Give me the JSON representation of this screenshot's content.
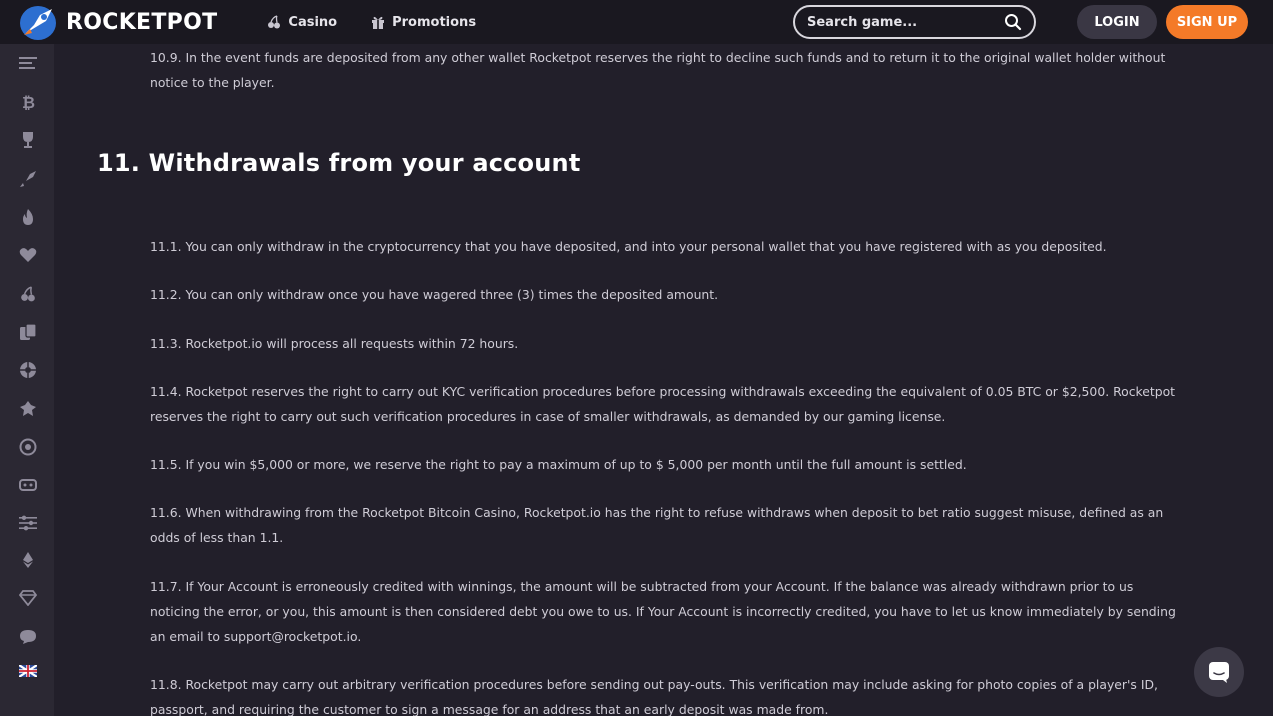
{
  "header": {
    "brand": "ROCKETPOT",
    "nav": [
      {
        "label": "Casino",
        "icon": "cherries-icon"
      },
      {
        "label": "Promotions",
        "icon": "gift-icon"
      }
    ],
    "search_placeholder": "Search game...",
    "login_label": "LOGIN",
    "signup_label": "SIGN UP"
  },
  "sidebar": {
    "items": [
      "menu-icon",
      "bitcoin-icon",
      "trophy-icon",
      "rocket-icon",
      "fire-icon",
      "heart-icon",
      "cherries-icon",
      "cards-icon",
      "roulette-icon",
      "poker-chip-icon",
      "coin-icon",
      "ticket-icon",
      "sliders-icon",
      "ethereum-icon",
      "diamond-icon",
      "chat-icon",
      "uk-flag-icon"
    ]
  },
  "content": {
    "p_10_9": "10.9. In the event funds are deposited from any other wallet Rocketpot reserves the right to decline such funds and to return it to the original wallet holder without notice to the player.",
    "heading": "11. Withdrawals from your account",
    "p_11_1": "11.1. You can only withdraw in the cryptocurrency that you have deposited, and into your personal wallet that you have registered with as you deposited.",
    "p_11_2": "11.2. You can only withdraw once you have wagered three (3) times the deposited amount.",
    "p_11_3": "11.3. Rocketpot.io will process all requests within 72 hours.",
    "p_11_4": "11.4. Rocketpot reserves the right to carry out KYC verification procedures before processing withdrawals exceeding the equivalent of 0.05 BTC or $2,500. Rocketpot reserves the right to carry out such verification procedures in case of smaller withdrawals, as demanded by our gaming license.",
    "p_11_5": "11.5. If you win $5,000 or more, we reserve the right to pay a maximum of up to $ 5,000 per month until the full amount is settled.",
    "p_11_6": "11.6. When withdrawing from the Rocketpot Bitcoin Casino, Rocketpot.io has the right to refuse withdraws when deposit to bet ratio suggest misuse, defined as an odds of less than 1.1.",
    "p_11_7": "11.7. If Your Account is erroneously credited with winnings, the amount will be subtracted from your Account. If the balance was already withdrawn prior to us noticing the error, or you, this amount is then considered debt you owe to us. If Your Account is incorrectly credited, you have to let us know immediately by sending an email to support@rocketpot.io.",
    "p_11_8": "11.8. Rocketpot may carry out arbitrary verification procedures before sending out pay-outs. This verification may include asking for photo copies of a player's ID, passport, and requiring the customer to sign a message for an address that an early deposit was made from."
  },
  "colors": {
    "background": "#221f2a",
    "topbar": "#1a1820",
    "sidebar": "#2b2833",
    "accent": "#f47a28"
  }
}
